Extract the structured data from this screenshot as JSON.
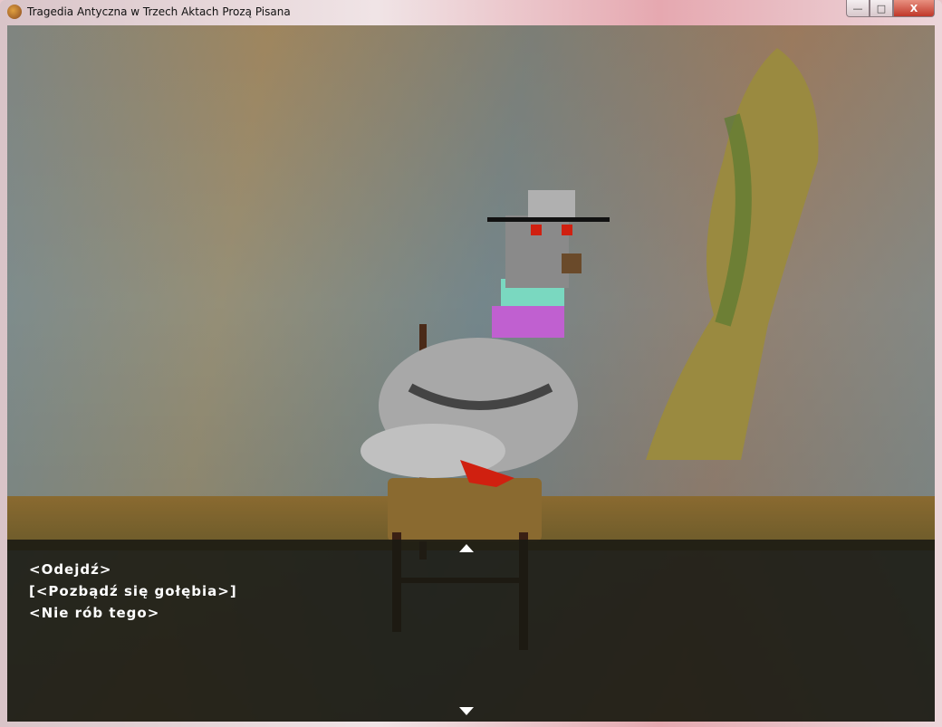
{
  "window": {
    "title": "Tragedia Antyczna w Trzech Aktach Prozą Pisana",
    "minimize": "—",
    "maximize": "□",
    "close": "X"
  },
  "dialog": {
    "options": [
      "<Odejdź>",
      "[<Pozbądź się gołębia>]",
      "<Nie rób tego>"
    ],
    "scroll_up": "scroll-up",
    "scroll_down": "scroll-down"
  }
}
